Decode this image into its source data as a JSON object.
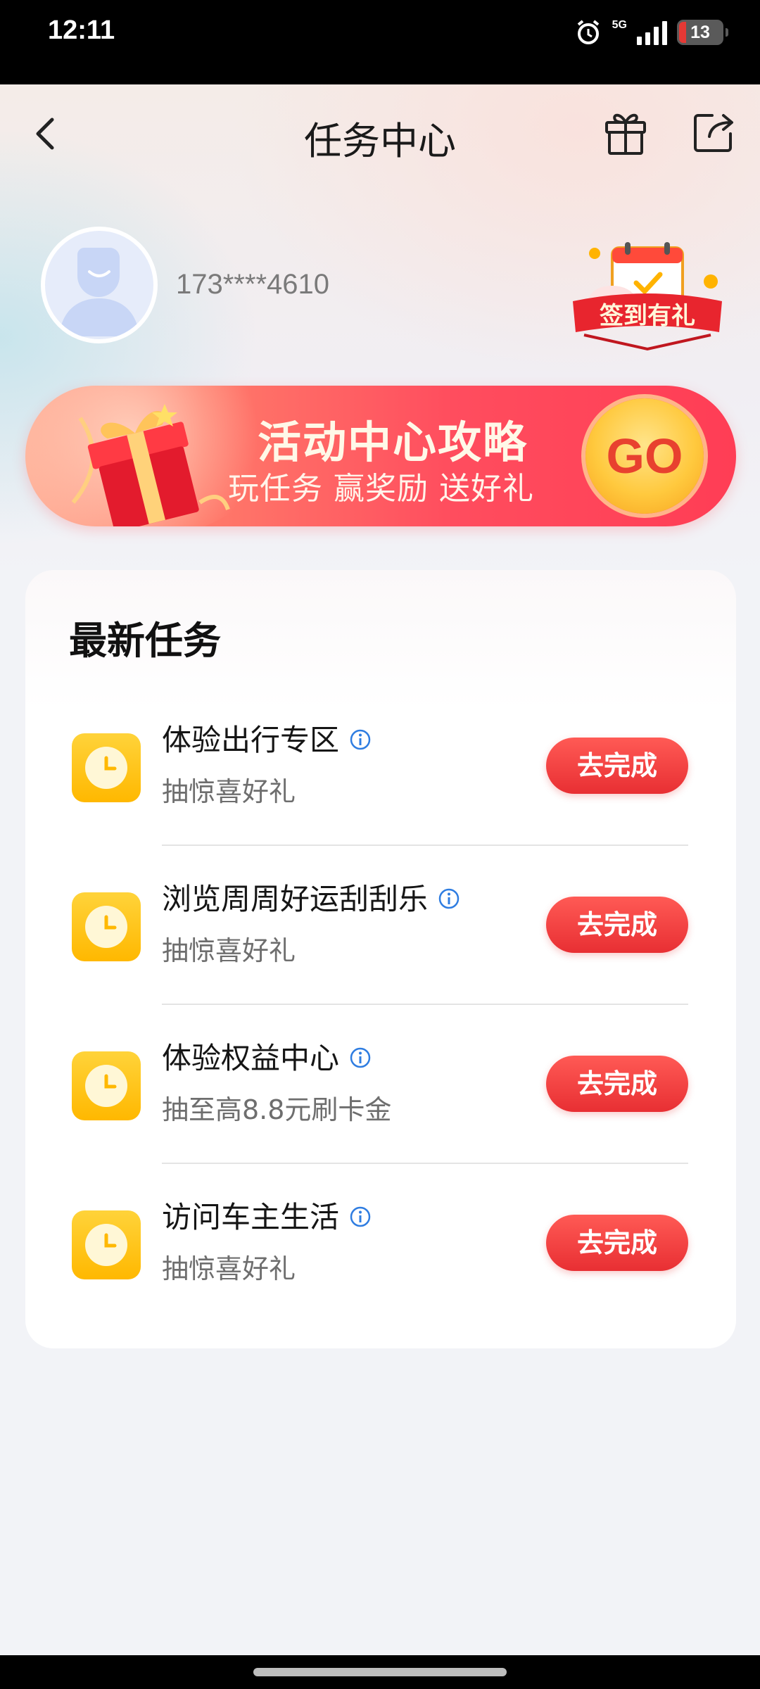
{
  "status_bar": {
    "time": "12:11",
    "network": "5G",
    "battery": "13"
  },
  "nav": {
    "title": "任务中心",
    "icons": [
      "back-icon",
      "gift-icon",
      "share-icon"
    ]
  },
  "profile": {
    "phone": "173****4610",
    "checkin_badge": "签到有礼"
  },
  "banner": {
    "title": "活动中心攻略",
    "subtitle": "玩任务 赢奖励 送好礼",
    "go_label": "GO"
  },
  "tasks_section": {
    "title": "最新任务",
    "items": [
      {
        "name": "体验出行专区",
        "desc": "抽惊喜好礼",
        "button": "去完成"
      },
      {
        "name": "浏览周周好运刮刮乐",
        "desc": "抽惊喜好礼",
        "button": "去完成"
      },
      {
        "name": "体验权益中心",
        "desc": "抽至高8.8元刷卡金",
        "button": "去完成"
      },
      {
        "name": "访问车主生活",
        "desc": "抽惊喜好礼",
        "button": "去完成"
      }
    ]
  },
  "colors": {
    "accent_red": "#e82f33",
    "task_icon_yellow": "#ffc20e",
    "info_blue": "#2f7de1"
  }
}
